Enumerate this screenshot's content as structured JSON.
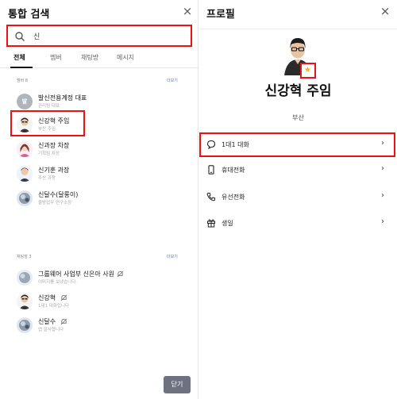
{
  "left": {
    "title": "통합 검색",
    "close_icon": "×",
    "search_value": "신",
    "tabs": [
      "전체",
      "멤버",
      "채팅방",
      "메시지"
    ],
    "members_section": {
      "label": "멤버 8",
      "more": "더보기"
    },
    "members": [
      {
        "name": "발신전용계정 대표",
        "sub": "관리팀 대표",
        "avatar_text": "발"
      },
      {
        "name": "신강혁 주임",
        "sub": "부산 주임"
      },
      {
        "name": "신과장 차장",
        "sub": "기획팀 차장"
      },
      {
        "name": "신기훈 과장",
        "sub": "주산 과장"
      },
      {
        "name": "신달수(달롱이)",
        "sub": "울방업무 연구소장"
      }
    ],
    "chats_section": {
      "label": "채팅방 3",
      "more": "더보기"
    },
    "chats": [
      {
        "name": "그룹웨어 사업부 신은아 사원",
        "sub": "이미지를 보냈습니다."
      },
      {
        "name": "신강혁",
        "sub": "1대1 대화입니다"
      },
      {
        "name": "신달수",
        "sub": "앱 잘사합니다"
      }
    ],
    "close_button": "닫기"
  },
  "right": {
    "title": "프로필",
    "close_icon": "×",
    "profile_name": "신강혁 주임",
    "department": "부산",
    "star_icon": "★",
    "menu": [
      {
        "label": "1대1 대화",
        "icon": "chat-bubble-icon"
      },
      {
        "label": "휴대전화",
        "icon": "mobile-phone-icon"
      },
      {
        "label": "유선전화",
        "icon": "phone-handset-icon"
      },
      {
        "label": "생일",
        "icon": "gift-icon"
      }
    ],
    "chevron": "›"
  },
  "colors": {
    "highlight": "#ee1111",
    "star": "#f2b21a",
    "link": "#4a7bd0",
    "close_button_bg": "#6e7280"
  }
}
